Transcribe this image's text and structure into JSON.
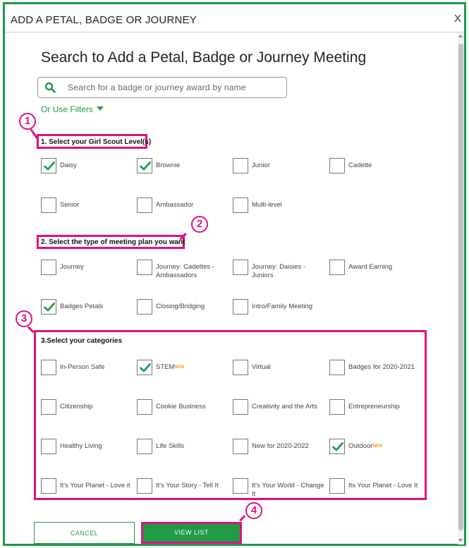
{
  "modal": {
    "title": "ADD A PETAL, BADGE OR JOURNEY",
    "close_label": "X"
  },
  "heading": "Search to Add a Petal, Badge or Journey Meeting",
  "search": {
    "placeholder": "Search for a badge or journey award by name"
  },
  "filters_link": "Or Use Filters",
  "annotations": [
    "1",
    "2",
    "3",
    "4"
  ],
  "sections": {
    "level": {
      "label": "1. Select your Girl Scout Level(s)",
      "options": [
        {
          "label": "Daisy",
          "checked": true
        },
        {
          "label": "Brownie",
          "checked": true
        },
        {
          "label": "Junior",
          "checked": false
        },
        {
          "label": "Cadette",
          "checked": false
        },
        {
          "label": "Senior",
          "checked": false
        },
        {
          "label": "Ambassador",
          "checked": false
        },
        {
          "label": "Multi-level",
          "checked": false
        }
      ]
    },
    "meeting_type": {
      "label": "2. Select the type of meeting plan you want",
      "options": [
        {
          "label": "Journey",
          "checked": false
        },
        {
          "label": "Journey: Cadettes - Ambassadors",
          "checked": false
        },
        {
          "label": "Journey: Daisies - Juniors",
          "checked": false
        },
        {
          "label": "Award Earning",
          "checked": false
        },
        {
          "label": "Badges Petals",
          "checked": true
        },
        {
          "label": "Closing/Bridging",
          "checked": false
        },
        {
          "label": "Intro/Family Meeting",
          "checked": false
        }
      ]
    },
    "categories": {
      "label": "3.Select your categories",
      "new_tag": "NEW",
      "options": [
        {
          "label": "In-Person Safe",
          "checked": false
        },
        {
          "label": "STEM",
          "checked": true,
          "new": true
        },
        {
          "label": "Virtual",
          "checked": false
        },
        {
          "label": "Badges for 2020-2021",
          "checked": false
        },
        {
          "label": "Citizenship",
          "checked": false
        },
        {
          "label": "Cookie Business",
          "checked": false
        },
        {
          "label": "Creativity and the Arts",
          "checked": false
        },
        {
          "label": "Entrepreneurship",
          "checked": false
        },
        {
          "label": "Healthy Living",
          "checked": false
        },
        {
          "label": "Life Skills",
          "checked": false
        },
        {
          "label": "New for 2020-2022",
          "checked": false
        },
        {
          "label": "Outdoor",
          "checked": true,
          "new": true
        },
        {
          "label": "It's Your Planet - Love it",
          "checked": false
        },
        {
          "label": "It's Your Story - Tell It",
          "checked": false
        },
        {
          "label": "It's Your World - Change It",
          "checked": false
        },
        {
          "label": "Its Your Planet - Love It",
          "checked": false
        }
      ]
    }
  },
  "buttons": {
    "cancel": "CANCEL",
    "view_list": "VIEW LIST"
  },
  "colors": {
    "brand_green": "#1f9b45",
    "annotation_pink": "#e0117f",
    "new_orange": "#f29a1b"
  }
}
